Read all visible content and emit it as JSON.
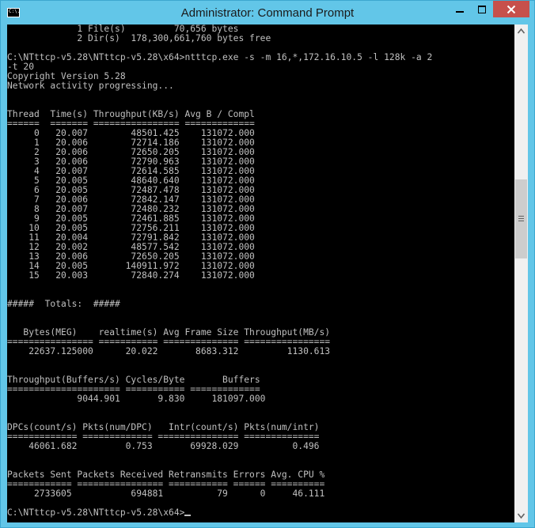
{
  "window": {
    "title": "Administrator: Command Prompt",
    "icon_label": "C:\\.",
    "icon": "console-app-icon",
    "colors": {
      "titlebar": "#62c6e8",
      "close": "#c7504b",
      "console_bg": "#000000",
      "console_text": "#c0c0c0"
    }
  },
  "console": {
    "lines": [
      "             1 File(s)         70,656 bytes",
      "             2 Dir(s)  178,300,661,760 bytes free",
      "",
      "C:\\NTttcp-v5.28\\NTttcp-v5.28\\x64>ntttcp.exe -s -m 16,*,172.16.10.5 -l 128k -a 2",
      "-t 20",
      "Copyright Version 5.28",
      "Network activity progressing...",
      "",
      "",
      "Thread  Time(s) Throughput(KB/s) Avg B / Compl",
      "======  ======= ================ =============",
      "     0   20.007        48501.425    131072.000",
      "     1   20.006        72714.186    131072.000",
      "     2   20.006        72650.205    131072.000",
      "     3   20.006        72790.963    131072.000",
      "     4   20.007        72614.585    131072.000",
      "     5   20.005        48640.640    131072.000",
      "     6   20.005        72487.478    131072.000",
      "     7   20.006        72842.147    131072.000",
      "     8   20.007        72480.232    131072.000",
      "     9   20.005        72461.885    131072.000",
      "    10   20.005        72756.211    131072.000",
      "    11   20.004        72791.842    131072.000",
      "    12   20.002        48577.542    131072.000",
      "    13   20.006        72650.205    131072.000",
      "    14   20.005       140911.972    131072.000",
      "    15   20.003        72840.274    131072.000",
      "",
      "",
      "#####  Totals:  #####",
      "",
      "",
      "   Bytes(MEG)    realtime(s) Avg Frame Size Throughput(MB/s)",
      "================ =========== ============== ================",
      "    22637.125000      20.022       8683.312         1130.613",
      "",
      "",
      "Throughput(Buffers/s) Cycles/Byte       Buffers",
      "===================== =========== =============",
      "             9044.901       9.830     181097.000",
      "",
      "",
      "DPCs(count/s) Pkts(num/DPC)   Intr(count/s) Pkts(num/intr)",
      "============= ============= =============== ==============",
      "    46061.682         0.753       69928.029          0.496",
      "",
      "",
      "Packets Sent Packets Received Retransmits Errors Avg. CPU %",
      "============ ================ =========== ====== ==========",
      "     2733605           694881          79      0     46.111",
      "",
      "C:\\NTttcp-v5.28\\NTttcp-v5.28\\x64>"
    ]
  }
}
